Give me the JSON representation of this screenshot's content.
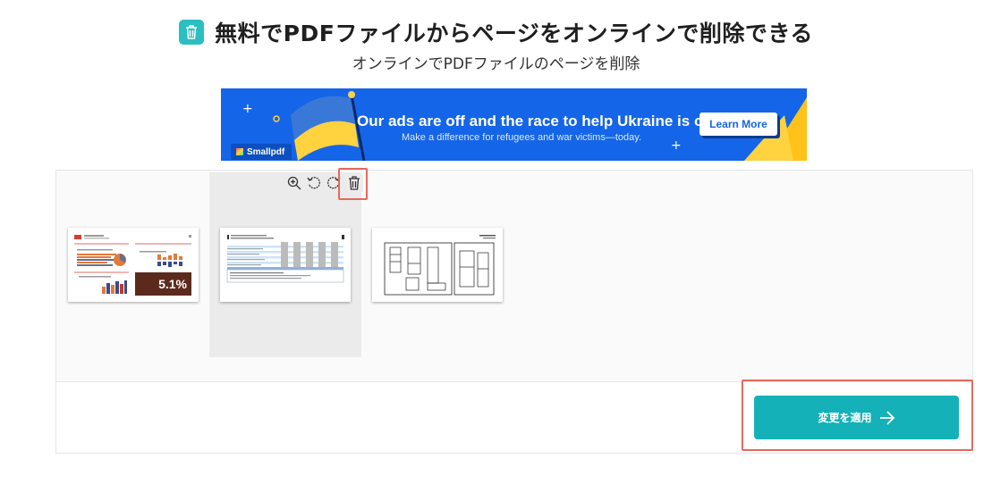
{
  "header": {
    "title": "無料でPDFファイルからページをオンラインで削除できる",
    "subtitle": "オンラインでPDFファイルのページを削除",
    "icon": "trash-icon"
  },
  "ad": {
    "headline": "Our ads are off and the race to help Ukraine is on",
    "subline": "Make a difference for refugees and war victims—today.",
    "button": "Learn More",
    "brand": "Smallpdf"
  },
  "pages": [
    {
      "name": "page-1",
      "badge": "5.1%"
    },
    {
      "name": "page-2",
      "selected": true
    },
    {
      "name": "page-3"
    }
  ],
  "page_tools": [
    "zoom-in-icon",
    "rotate-left-icon",
    "rotate-right-icon",
    "trash-icon"
  ],
  "apply": {
    "label": "変更を適用",
    "icon": "arrow-right-icon"
  },
  "colors": {
    "accent": "#14b1b8",
    "highlight": "#e36b5c",
    "ad_blue": "#1565e8",
    "flag_blue": "#3a78d8",
    "flag_yellow": "#ffd23f"
  }
}
